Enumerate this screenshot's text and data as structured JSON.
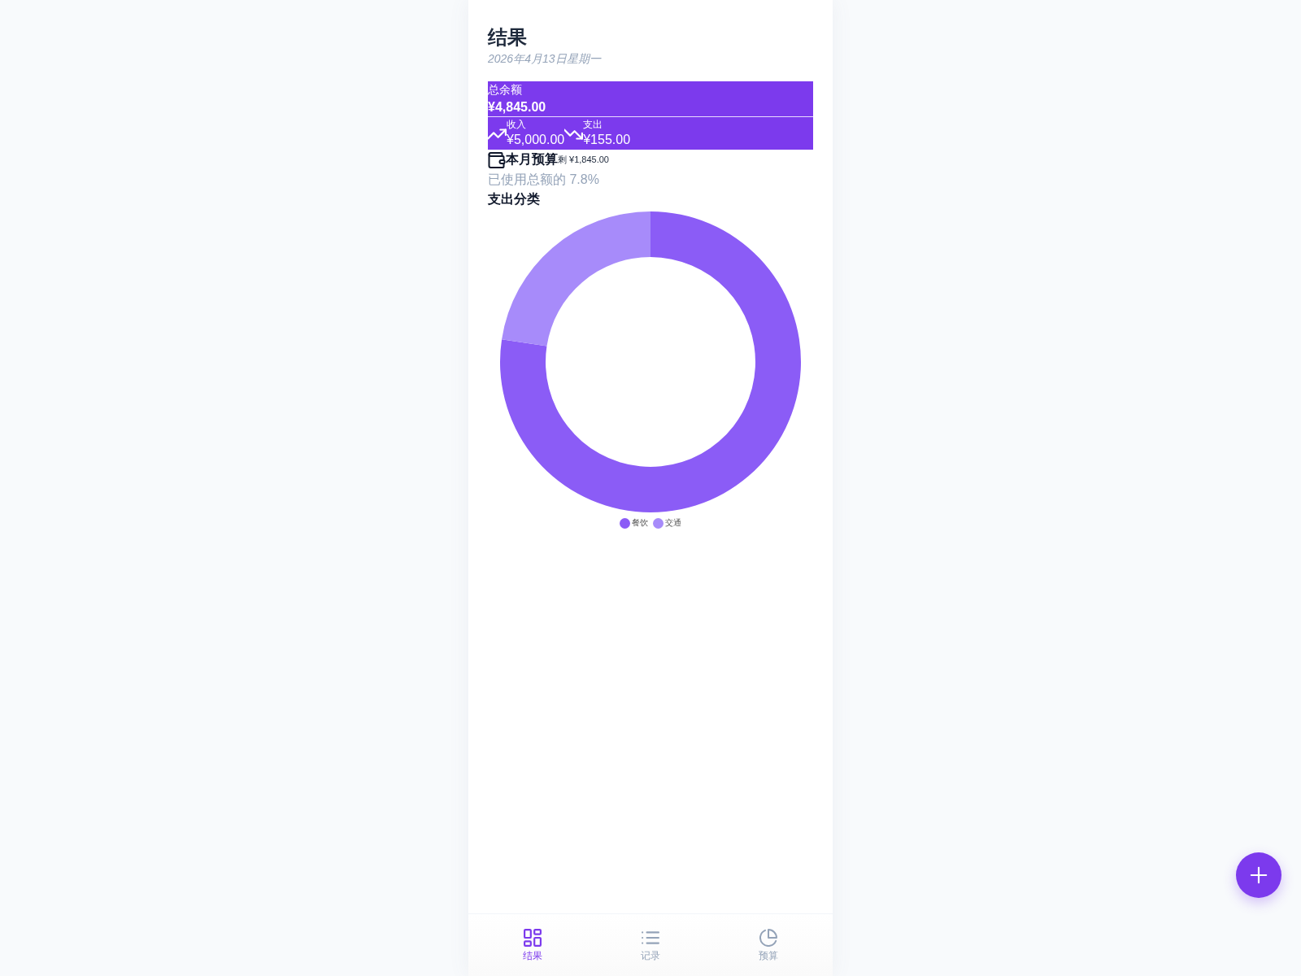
{
  "header": {
    "title": "结果",
    "date": "2026年4月13日星期一"
  },
  "balance_card": {
    "label": "总余额",
    "amount": "¥4,845.00",
    "flows": [
      {
        "kind": "income",
        "label": "收入",
        "amount": "¥5,000.00"
      },
      {
        "kind": "expense",
        "label": "支出",
        "amount": "¥155.00"
      }
    ]
  },
  "budget": {
    "title": "本月预算",
    "remaining": "剩 ¥1,845.00",
    "usage": "已使用总额的 7.8%"
  },
  "expense_breakdown": {
    "title": "支出分类",
    "chart_data": {
      "type": "donut",
      "categories": [
        "餐饮",
        "交通"
      ],
      "values": [
        77.4,
        22.6
      ],
      "colors": [
        "#8b5cf6",
        "#a78bfa"
      ],
      "legend": "bottom"
    }
  },
  "nav": [
    {
      "kind": "overview",
      "label": "结果",
      "selected": true
    },
    {
      "kind": "records",
      "label": "记录",
      "selected": false
    },
    {
      "kind": "budget",
      "label": "预算",
      "selected": false
    }
  ]
}
